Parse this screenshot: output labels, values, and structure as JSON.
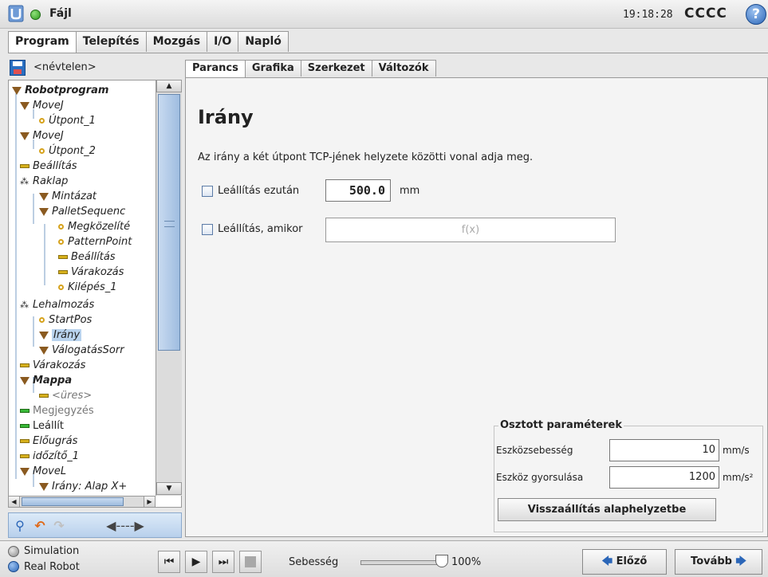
{
  "titlebar": {
    "menu_label": "Fájl",
    "clock": "19:18:28",
    "robot_name": "CCCC",
    "help_glyph": "?",
    "status_color": "#2e9a1e"
  },
  "main_tabs": [
    "Program",
    "Telepítés",
    "Mozgás",
    "I/O",
    "Napló"
  ],
  "left": {
    "program_name": "<névtelen>",
    "tree": [
      {
        "label": "Robotprogram",
        "icon": "triangle-icon"
      },
      {
        "label": "MoveJ",
        "icon": "triangle-icon"
      },
      {
        "label": "Útpont_1",
        "icon": "waypoint-icon"
      },
      {
        "label": "MoveJ",
        "icon": "triangle-icon"
      },
      {
        "label": "Útpont_2",
        "icon": "waypoint-icon"
      },
      {
        "label": "Beállítás",
        "icon": "bar-icon"
      },
      {
        "label": "Raklap",
        "icon": "pallet-icon"
      },
      {
        "label": "Mintázat",
        "icon": "triangle-icon"
      },
      {
        "label": "PalletSequenc",
        "icon": "triangle-icon"
      },
      {
        "label": "Megközelíté",
        "icon": "waypoint-icon"
      },
      {
        "label": "PatternPoint",
        "icon": "waypoint-icon"
      },
      {
        "label": "Beállítás",
        "icon": "bar-icon"
      },
      {
        "label": "Várakozás",
        "icon": "bar-icon"
      },
      {
        "label": "Kilépés_1",
        "icon": "waypoint-icon"
      },
      {
        "label": "Lehalmozás",
        "icon": "pallet-icon"
      },
      {
        "label": "StartPos",
        "icon": "waypoint-icon"
      },
      {
        "label": "Irány",
        "icon": "triangle-icon"
      },
      {
        "label": "VálogatásSorr",
        "icon": "triangle-icon"
      },
      {
        "label": "Várakozás",
        "icon": "bar-icon"
      },
      {
        "label": "Mappa",
        "icon": "triangle-icon"
      },
      {
        "label": "<üres>",
        "icon": "bar-icon"
      },
      {
        "label": "Megjegyzés",
        "icon": "green-bar-icon"
      },
      {
        "label": "Leállít",
        "icon": "green-bar-icon"
      },
      {
        "label": "Előugrás",
        "icon": "bar-icon"
      },
      {
        "label": "időzítő_1",
        "icon": "bar-icon"
      },
      {
        "label": "MoveL",
        "icon": "triangle-icon"
      },
      {
        "label": "Irány: Alap X+",
        "icon": "triangle-icon"
      }
    ],
    "tools": [
      "search-icon",
      "undo-icon",
      "redo-icon",
      "move-arrows-icon"
    ]
  },
  "sub_tabs": [
    "Parancs",
    "Grafika",
    "Szerkezet",
    "Változók"
  ],
  "command": {
    "title": "Irány",
    "description": "Az irány a két útpont TCP-jének helyzete közötti vonal adja meg.",
    "stop_after_label": "Leállítás ezután",
    "stop_after_value": "500.0",
    "stop_after_unit": "mm",
    "stop_when_label": "Leállítás, amikor",
    "stop_when_placeholder": "f(x)"
  },
  "params": {
    "title": "Osztott paraméterek",
    "speed_label": "Eszközsebesség",
    "speed_value": "10",
    "speed_unit": "mm/s",
    "accel_label": "Eszköz gyorsulása",
    "accel_value": "1200",
    "accel_unit": "mm/s²",
    "reset_label": "Visszaállítás alaphelyzetbe"
  },
  "bottom": {
    "mode_simulation": "Simulation",
    "mode_real": "Real Robot",
    "speed_label": "Sebesség",
    "speed_value": "100%",
    "speed_fraction": 1.0,
    "prev_label": "Előző",
    "next_label": "Tovább"
  }
}
